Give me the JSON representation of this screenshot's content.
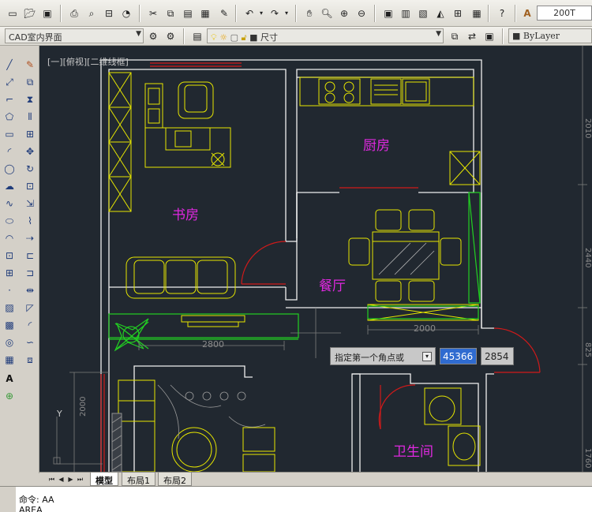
{
  "toolbar": {
    "workspace": "CAD室内界面",
    "layer": "尺寸",
    "linetype": "ByLayer",
    "scale_value": "200T"
  },
  "canvas": {
    "view_label": "[一][俯视][二维线框]",
    "rooms": {
      "study": "书房",
      "kitchen": "厨房",
      "dining": "餐厅",
      "bathroom": "卫生间"
    },
    "dims": {
      "d2800": "2800",
      "d2000_h": "2000",
      "d2000_v": "2000",
      "d2010": "2010",
      "d2440": "2440",
      "d825": "825",
      "d1760": "1760"
    },
    "ucs_label": "Y"
  },
  "dynamic_input": {
    "prompt": "指定第一个角点或",
    "value1": "45366",
    "value2": "2854"
  },
  "tabs": [
    "模型",
    "布局1",
    "布局2"
  ],
  "command": {
    "line1": "命令:  AA",
    "line2": "AREA"
  },
  "colors": {
    "canvas_bg": "#212830",
    "wall": "#f0f0f0",
    "furniture": "#e6e600",
    "text_room": "#e028e0",
    "door": "#d11a1a",
    "green": "#22d022"
  }
}
